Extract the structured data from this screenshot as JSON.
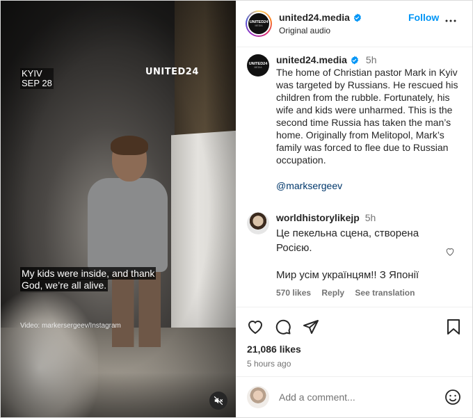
{
  "video": {
    "location": "KYIV",
    "date": "SEP 28",
    "brand": "UNITED24",
    "subtitle": "My kids were inside, and thank God, we’re all alive.",
    "credit": "Video: markersergeev/Instagram"
  },
  "header": {
    "username": "united24.media",
    "audio": "Original audio",
    "follow_label": "Follow",
    "avatar_text": "UNITED24",
    "avatar_sub": "MEDIA"
  },
  "caption": {
    "username": "united24.media",
    "time": "5h",
    "text": "The home of Christian pastor Mark in Kyiv was targeted by Russians. He rescued his children from the rubble. Fortunately, his wife and kids were unharmed. This is the second time Russia has taken the man’s home. Originally from Melitopol, Mark’s family was forced to flee due to Russian occupation.",
    "mention": "@marksergeev"
  },
  "comment": {
    "username": "worldhistorylikejp",
    "time": "5h",
    "text": "Це пекельна сцена, створена Росією.",
    "text2": "Мир усім українцям!! З Японії",
    "likes": "570 likes",
    "reply": "Reply",
    "translate": "See translation"
  },
  "stats": {
    "likes": "21,086 likes",
    "ago": "5 hours ago"
  },
  "add_comment": {
    "placeholder": "Add a comment..."
  },
  "colors": {
    "accent": "#0095f6",
    "verified": "#0095f6",
    "muted": "#737373"
  }
}
